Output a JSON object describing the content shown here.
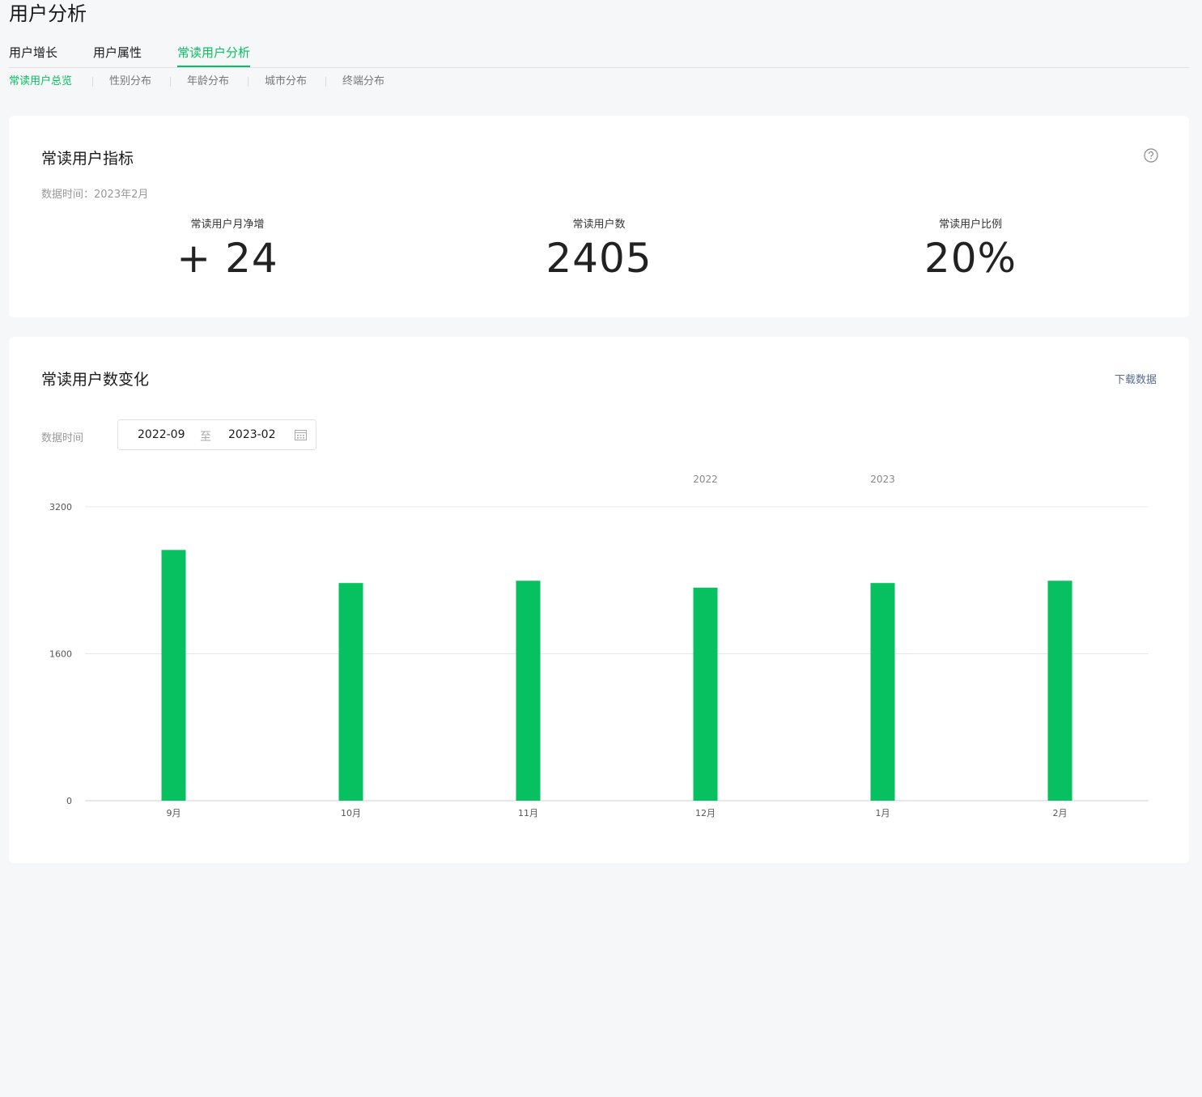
{
  "page": {
    "title": "用户分析"
  },
  "tabs": [
    {
      "label": "用户增长"
    },
    {
      "label": "用户属性"
    },
    {
      "label": "常读用户分析"
    }
  ],
  "subtabs": [
    {
      "label": "常读用户总览"
    },
    {
      "label": "性别分布"
    },
    {
      "label": "年龄分布"
    },
    {
      "label": "城市分布"
    },
    {
      "label": "终端分布"
    }
  ],
  "metrics_card": {
    "title": "常读用户指标",
    "data_time": "数据时间：2023年2月",
    "metrics": [
      {
        "label": "常读用户月净增",
        "value": "+ 24"
      },
      {
        "label": "常读用户数",
        "value": "2405"
      },
      {
        "label": "常读用户比例",
        "value": "20%"
      }
    ]
  },
  "trend_card": {
    "title": "常读用户数变化",
    "download_label": "下载数据",
    "range_label": "数据时间",
    "range_start": "2022-09",
    "range_to": "至",
    "range_end": "2023-02"
  },
  "colors": {
    "accent": "#07c160",
    "link": "#576b95"
  },
  "icons": {
    "help": "help-circle-icon",
    "calendar": "calendar-icon"
  },
  "chart_data": {
    "type": "bar",
    "categories": [
      "9月",
      "10月",
      "11月",
      "12月",
      "1月",
      "2月"
    ],
    "year_labels": [
      {
        "label": "2022",
        "category": "12月"
      },
      {
        "label": "2023",
        "category": "1月"
      }
    ],
    "series": [
      {
        "values": [
          2730,
          2370,
          2395,
          2320,
          2370,
          2395
        ]
      }
    ],
    "yticks": [
      0,
      1600,
      3200
    ],
    "ylim": [
      0,
      3200
    ],
    "grid": true,
    "color": "#07c160"
  }
}
